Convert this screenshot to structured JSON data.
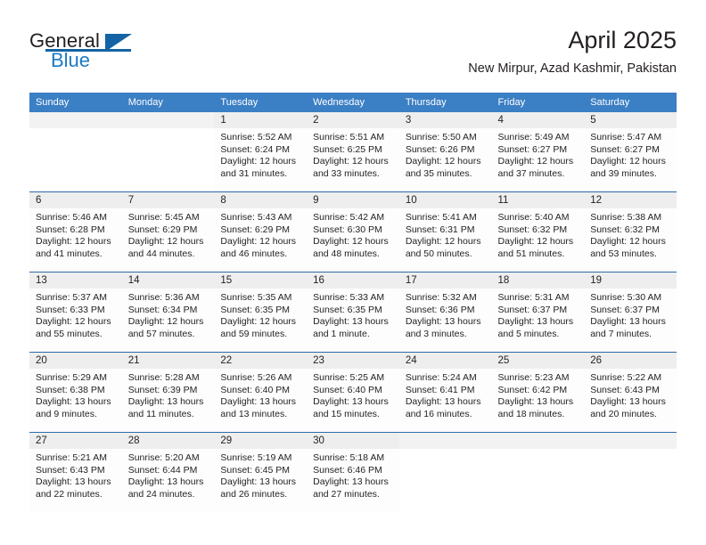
{
  "brand": {
    "name_part1": "General",
    "name_part2": "Blue",
    "logo_icon": "triangle-flag-icon",
    "accent_color": "#1464a5",
    "blue_text_color": "#1c7bc4"
  },
  "header": {
    "title": "April 2025",
    "subtitle": "New Mirpur, Azad Kashmir, Pakistan"
  },
  "theme": {
    "header_row_bg": "#3b7fc4",
    "row_divider": "#2d6ca8",
    "datenum_bg": "#eeeeee",
    "cell_bg": "#fdfdfd",
    "text": "#231f20"
  },
  "calendar": {
    "day_headers": [
      "Sunday",
      "Monday",
      "Tuesday",
      "Wednesday",
      "Thursday",
      "Friday",
      "Saturday"
    ],
    "labels": {
      "sunrise": "Sunrise:",
      "sunset": "Sunset:",
      "daylight": "Daylight:"
    },
    "weeks": [
      [
        {
          "date": "",
          "empty": true
        },
        {
          "date": "",
          "empty": true
        },
        {
          "date": "1",
          "sunrise": "Sunrise: 5:52 AM",
          "sunset": "Sunset: 6:24 PM",
          "daylight_l1": "Daylight: 12 hours",
          "daylight_l2": "and 31 minutes."
        },
        {
          "date": "2",
          "sunrise": "Sunrise: 5:51 AM",
          "sunset": "Sunset: 6:25 PM",
          "daylight_l1": "Daylight: 12 hours",
          "daylight_l2": "and 33 minutes."
        },
        {
          "date": "3",
          "sunrise": "Sunrise: 5:50 AM",
          "sunset": "Sunset: 6:26 PM",
          "daylight_l1": "Daylight: 12 hours",
          "daylight_l2": "and 35 minutes."
        },
        {
          "date": "4",
          "sunrise": "Sunrise: 5:49 AM",
          "sunset": "Sunset: 6:27 PM",
          "daylight_l1": "Daylight: 12 hours",
          "daylight_l2": "and 37 minutes."
        },
        {
          "date": "5",
          "sunrise": "Sunrise: 5:47 AM",
          "sunset": "Sunset: 6:27 PM",
          "daylight_l1": "Daylight: 12 hours",
          "daylight_l2": "and 39 minutes."
        }
      ],
      [
        {
          "date": "6",
          "sunrise": "Sunrise: 5:46 AM",
          "sunset": "Sunset: 6:28 PM",
          "daylight_l1": "Daylight: 12 hours",
          "daylight_l2": "and 41 minutes."
        },
        {
          "date": "7",
          "sunrise": "Sunrise: 5:45 AM",
          "sunset": "Sunset: 6:29 PM",
          "daylight_l1": "Daylight: 12 hours",
          "daylight_l2": "and 44 minutes."
        },
        {
          "date": "8",
          "sunrise": "Sunrise: 5:43 AM",
          "sunset": "Sunset: 6:29 PM",
          "daylight_l1": "Daylight: 12 hours",
          "daylight_l2": "and 46 minutes."
        },
        {
          "date": "9",
          "sunrise": "Sunrise: 5:42 AM",
          "sunset": "Sunset: 6:30 PM",
          "daylight_l1": "Daylight: 12 hours",
          "daylight_l2": "and 48 minutes."
        },
        {
          "date": "10",
          "sunrise": "Sunrise: 5:41 AM",
          "sunset": "Sunset: 6:31 PM",
          "daylight_l1": "Daylight: 12 hours",
          "daylight_l2": "and 50 minutes."
        },
        {
          "date": "11",
          "sunrise": "Sunrise: 5:40 AM",
          "sunset": "Sunset: 6:32 PM",
          "daylight_l1": "Daylight: 12 hours",
          "daylight_l2": "and 51 minutes."
        },
        {
          "date": "12",
          "sunrise": "Sunrise: 5:38 AM",
          "sunset": "Sunset: 6:32 PM",
          "daylight_l1": "Daylight: 12 hours",
          "daylight_l2": "and 53 minutes."
        }
      ],
      [
        {
          "date": "13",
          "sunrise": "Sunrise: 5:37 AM",
          "sunset": "Sunset: 6:33 PM",
          "daylight_l1": "Daylight: 12 hours",
          "daylight_l2": "and 55 minutes."
        },
        {
          "date": "14",
          "sunrise": "Sunrise: 5:36 AM",
          "sunset": "Sunset: 6:34 PM",
          "daylight_l1": "Daylight: 12 hours",
          "daylight_l2": "and 57 minutes."
        },
        {
          "date": "15",
          "sunrise": "Sunrise: 5:35 AM",
          "sunset": "Sunset: 6:35 PM",
          "daylight_l1": "Daylight: 12 hours",
          "daylight_l2": "and 59 minutes."
        },
        {
          "date": "16",
          "sunrise": "Sunrise: 5:33 AM",
          "sunset": "Sunset: 6:35 PM",
          "daylight_l1": "Daylight: 13 hours",
          "daylight_l2": "and 1 minute."
        },
        {
          "date": "17",
          "sunrise": "Sunrise: 5:32 AM",
          "sunset": "Sunset: 6:36 PM",
          "daylight_l1": "Daylight: 13 hours",
          "daylight_l2": "and 3 minutes."
        },
        {
          "date": "18",
          "sunrise": "Sunrise: 5:31 AM",
          "sunset": "Sunset: 6:37 PM",
          "daylight_l1": "Daylight: 13 hours",
          "daylight_l2": "and 5 minutes."
        },
        {
          "date": "19",
          "sunrise": "Sunrise: 5:30 AM",
          "sunset": "Sunset: 6:37 PM",
          "daylight_l1": "Daylight: 13 hours",
          "daylight_l2": "and 7 minutes."
        }
      ],
      [
        {
          "date": "20",
          "sunrise": "Sunrise: 5:29 AM",
          "sunset": "Sunset: 6:38 PM",
          "daylight_l1": "Daylight: 13 hours",
          "daylight_l2": "and 9 minutes."
        },
        {
          "date": "21",
          "sunrise": "Sunrise: 5:28 AM",
          "sunset": "Sunset: 6:39 PM",
          "daylight_l1": "Daylight: 13 hours",
          "daylight_l2": "and 11 minutes."
        },
        {
          "date": "22",
          "sunrise": "Sunrise: 5:26 AM",
          "sunset": "Sunset: 6:40 PM",
          "daylight_l1": "Daylight: 13 hours",
          "daylight_l2": "and 13 minutes."
        },
        {
          "date": "23",
          "sunrise": "Sunrise: 5:25 AM",
          "sunset": "Sunset: 6:40 PM",
          "daylight_l1": "Daylight: 13 hours",
          "daylight_l2": "and 15 minutes."
        },
        {
          "date": "24",
          "sunrise": "Sunrise: 5:24 AM",
          "sunset": "Sunset: 6:41 PM",
          "daylight_l1": "Daylight: 13 hours",
          "daylight_l2": "and 16 minutes."
        },
        {
          "date": "25",
          "sunrise": "Sunrise: 5:23 AM",
          "sunset": "Sunset: 6:42 PM",
          "daylight_l1": "Daylight: 13 hours",
          "daylight_l2": "and 18 minutes."
        },
        {
          "date": "26",
          "sunrise": "Sunrise: 5:22 AM",
          "sunset": "Sunset: 6:43 PM",
          "daylight_l1": "Daylight: 13 hours",
          "daylight_l2": "and 20 minutes."
        }
      ],
      [
        {
          "date": "27",
          "sunrise": "Sunrise: 5:21 AM",
          "sunset": "Sunset: 6:43 PM",
          "daylight_l1": "Daylight: 13 hours",
          "daylight_l2": "and 22 minutes."
        },
        {
          "date": "28",
          "sunrise": "Sunrise: 5:20 AM",
          "sunset": "Sunset: 6:44 PM",
          "daylight_l1": "Daylight: 13 hours",
          "daylight_l2": "and 24 minutes."
        },
        {
          "date": "29",
          "sunrise": "Sunrise: 5:19 AM",
          "sunset": "Sunset: 6:45 PM",
          "daylight_l1": "Daylight: 13 hours",
          "daylight_l2": "and 26 minutes."
        },
        {
          "date": "30",
          "sunrise": "Sunrise: 5:18 AM",
          "sunset": "Sunset: 6:46 PM",
          "daylight_l1": "Daylight: 13 hours",
          "daylight_l2": "and 27 minutes."
        },
        {
          "date": "",
          "empty": true
        },
        {
          "date": "",
          "empty": true
        },
        {
          "date": "",
          "empty": true
        }
      ]
    ]
  }
}
